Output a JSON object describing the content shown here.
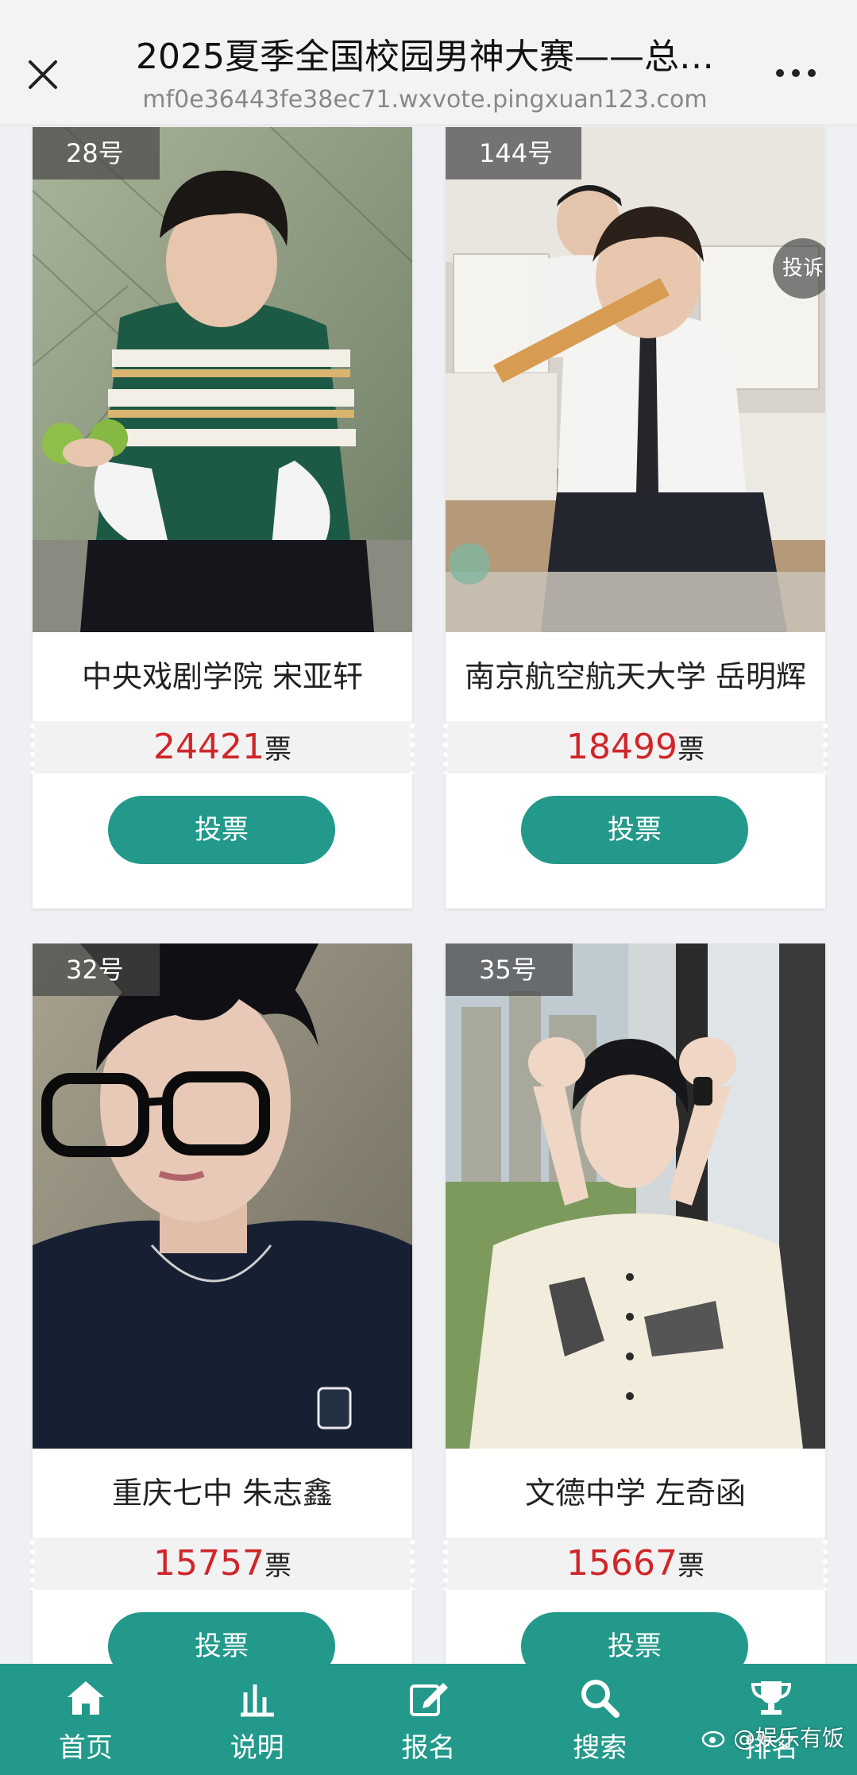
{
  "header": {
    "title": "2025夏季全国校园男神大赛——总…",
    "url": "mf0e36443fe38ec71.wxvote.pingxuan123.com"
  },
  "icons": {
    "close": "close-icon",
    "more": "more-dots-icon"
  },
  "contestants": [
    {
      "number": "28号",
      "name": "中央戏剧学院 宋亚轩",
      "votes": "24421",
      "unit": "票",
      "button": "投票"
    },
    {
      "number": "144号",
      "name": "南京航空航天大学 岳明辉",
      "votes": "18499",
      "unit": "票",
      "button": "投票",
      "complain": "投诉"
    },
    {
      "number": "32号",
      "name": "重庆七中 朱志鑫",
      "votes": "15757",
      "unit": "票",
      "button": "投票"
    },
    {
      "number": "35号",
      "name": "文德中学 左奇函",
      "votes": "15667",
      "unit": "票",
      "button": "投票"
    }
  ],
  "nav": [
    {
      "label": "首页",
      "icon": "home-icon"
    },
    {
      "label": "说明",
      "icon": "bar-chart-icon"
    },
    {
      "label": "报名",
      "icon": "edit-icon"
    },
    {
      "label": "搜索",
      "icon": "search-icon"
    },
    {
      "label": "排名",
      "icon": "trophy-icon"
    }
  ],
  "watermark": "@娱乐有饭",
  "colors": {
    "accent": "#22998a",
    "vote_count": "#d0262a"
  }
}
